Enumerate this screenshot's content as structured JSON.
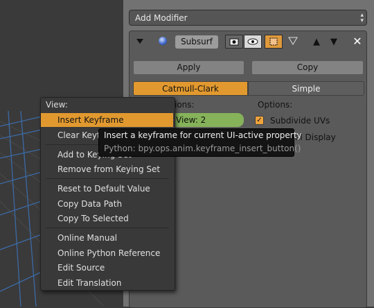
{
  "add_modifier": {
    "label": "Add Modifier"
  },
  "modifier": {
    "name": "Subsurf",
    "apply_label": "Apply",
    "copy_label": "Copy",
    "algorithms": [
      "Catmull-Clark",
      "Simple"
    ],
    "selected_algorithm": "Catmull-Clark",
    "subdivisions_label_tail": "ions:",
    "view_label": "View: 2",
    "options_label": "Options:",
    "subdivide_uvs": {
      "label": "Subdivide UVs",
      "checked": true
    },
    "optimal_display_tail": "al Display"
  },
  "context_menu": {
    "title": "View:",
    "groups": [
      [
        "Insert Keyframe",
        "Clear Keyfr"
      ],
      [
        "Add to Keying Set",
        "Remove from Keying Set"
      ],
      [
        "Reset to Default Value",
        "Copy Data Path",
        "Copy To Selected"
      ],
      [
        "Online Manual",
        "Online Python Reference",
        "Edit Source",
        "Edit Translation"
      ]
    ],
    "highlighted": "Insert Keyframe"
  },
  "tooltip": {
    "description": "Insert a keyframe for current UI-active property",
    "python": "Python: bpy.ops.anim.keyframe_insert_button()"
  },
  "colors": {
    "accent": "#e1992f",
    "field_green": "#86b35a",
    "panel": "#727272"
  }
}
